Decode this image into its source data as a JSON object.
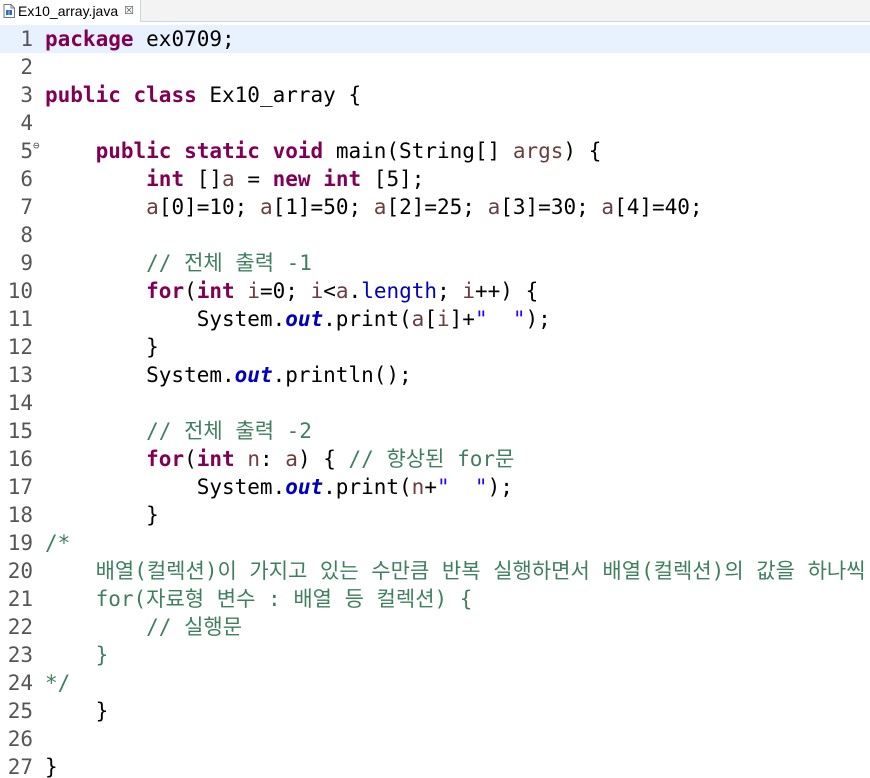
{
  "tab": {
    "filename": "Ex10_array.java",
    "close_glyph": "☒"
  },
  "editor": {
    "current_line": 1,
    "lines": [
      {
        "n": "1",
        "tokens": [
          [
            "kw",
            "package"
          ],
          [
            "p",
            " ex0709;"
          ]
        ]
      },
      {
        "n": "2",
        "tokens": []
      },
      {
        "n": "3",
        "tokens": [
          [
            "kw",
            "public"
          ],
          [
            "p",
            " "
          ],
          [
            "kw",
            "class"
          ],
          [
            "p",
            " Ex10_array {"
          ]
        ]
      },
      {
        "n": "4",
        "tokens": []
      },
      {
        "n": "5",
        "fold": true,
        "tokens": [
          [
            "p",
            "    "
          ],
          [
            "kw",
            "public"
          ],
          [
            "p",
            " "
          ],
          [
            "kw",
            "static"
          ],
          [
            "p",
            " "
          ],
          [
            "kw",
            "void"
          ],
          [
            "p",
            " main(String[] "
          ],
          [
            "vr",
            "args"
          ],
          [
            "p",
            ") {"
          ]
        ]
      },
      {
        "n": "6",
        "tokens": [
          [
            "p",
            "        "
          ],
          [
            "kw",
            "int"
          ],
          [
            "p",
            " []"
          ],
          [
            "vr",
            "a"
          ],
          [
            "p",
            " = "
          ],
          [
            "kw",
            "new"
          ],
          [
            "p",
            " "
          ],
          [
            "kw",
            "int"
          ],
          [
            "p",
            " [5];"
          ]
        ]
      },
      {
        "n": "7",
        "tokens": [
          [
            "p",
            "        "
          ],
          [
            "vr",
            "a"
          ],
          [
            "p",
            "[0]=10; "
          ],
          [
            "vr",
            "a"
          ],
          [
            "p",
            "[1]=50; "
          ],
          [
            "vr",
            "a"
          ],
          [
            "p",
            "[2]=25; "
          ],
          [
            "vr",
            "a"
          ],
          [
            "p",
            "[3]=30; "
          ],
          [
            "vr",
            "a"
          ],
          [
            "p",
            "[4]=40;"
          ]
        ]
      },
      {
        "n": "8",
        "tokens": []
      },
      {
        "n": "9",
        "tokens": [
          [
            "p",
            "        "
          ],
          [
            "cm",
            "// 전체 출력 -1"
          ]
        ]
      },
      {
        "n": "10",
        "tokens": [
          [
            "p",
            "        "
          ],
          [
            "kw",
            "for"
          ],
          [
            "p",
            "("
          ],
          [
            "kw",
            "int"
          ],
          [
            "p",
            " "
          ],
          [
            "vr",
            "i"
          ],
          [
            "p",
            "=0; "
          ],
          [
            "vr",
            "i"
          ],
          [
            "p",
            "<"
          ],
          [
            "vr",
            "a"
          ],
          [
            "p",
            "."
          ],
          [
            "fld",
            "length"
          ],
          [
            "p",
            "; "
          ],
          [
            "vr",
            "i"
          ],
          [
            "p",
            "++) {"
          ]
        ]
      },
      {
        "n": "11",
        "tokens": [
          [
            "p",
            "            System."
          ],
          [
            "sf",
            "out"
          ],
          [
            "p",
            ".print("
          ],
          [
            "vr",
            "a"
          ],
          [
            "p",
            "["
          ],
          [
            "vr",
            "i"
          ],
          [
            "p",
            "]+"
          ],
          [
            "str",
            "\"  \""
          ],
          [
            "p",
            ");"
          ]
        ]
      },
      {
        "n": "12",
        "tokens": [
          [
            "p",
            "        }"
          ]
        ]
      },
      {
        "n": "13",
        "tokens": [
          [
            "p",
            "        System."
          ],
          [
            "sf",
            "out"
          ],
          [
            "p",
            ".println();"
          ]
        ]
      },
      {
        "n": "14",
        "tokens": []
      },
      {
        "n": "15",
        "tokens": [
          [
            "p",
            "        "
          ],
          [
            "cm",
            "// 전체 출력 -2"
          ]
        ]
      },
      {
        "n": "16",
        "tokens": [
          [
            "p",
            "        "
          ],
          [
            "kw",
            "for"
          ],
          [
            "p",
            "("
          ],
          [
            "kw",
            "int"
          ],
          [
            "p",
            " "
          ],
          [
            "vr",
            "n"
          ],
          [
            "p",
            ": "
          ],
          [
            "vr",
            "a"
          ],
          [
            "p",
            ") { "
          ],
          [
            "cm",
            "// 향상된 for문"
          ]
        ]
      },
      {
        "n": "17",
        "tokens": [
          [
            "p",
            "            System."
          ],
          [
            "sf",
            "out"
          ],
          [
            "p",
            ".print("
          ],
          [
            "vr",
            "n"
          ],
          [
            "p",
            "+"
          ],
          [
            "str",
            "\"  \""
          ],
          [
            "p",
            ");"
          ]
        ]
      },
      {
        "n": "18",
        "tokens": [
          [
            "p",
            "        }"
          ]
        ]
      },
      {
        "n": "19",
        "tokens": [
          [
            "cm",
            "/*"
          ]
        ]
      },
      {
        "n": "20",
        "tokens": [
          [
            "cm",
            "    배열(컬렉션)이 가지고 있는 수만큼 반복 실행하면서 배열(컬렉션)의 값을 하나씩"
          ]
        ]
      },
      {
        "n": "21",
        "tokens": [
          [
            "cm",
            "    for(자료형 변수 : 배열 등 컬렉션) {"
          ]
        ]
      },
      {
        "n": "22",
        "tokens": [
          [
            "cm",
            "        // 실행문"
          ]
        ]
      },
      {
        "n": "23",
        "tokens": [
          [
            "cm",
            "    }"
          ]
        ]
      },
      {
        "n": "24",
        "tokens": [
          [
            "cm",
            "*/"
          ]
        ]
      },
      {
        "n": "25",
        "tokens": [
          [
            "p",
            "    }"
          ]
        ]
      },
      {
        "n": "26",
        "tokens": []
      },
      {
        "n": "27",
        "tokens": [
          [
            "p",
            "}"
          ]
        ]
      }
    ]
  }
}
